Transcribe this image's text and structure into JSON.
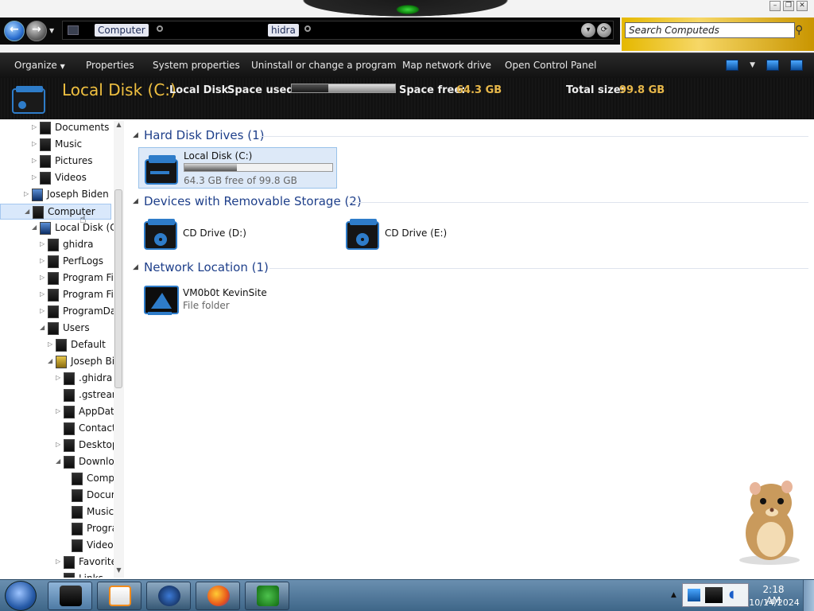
{
  "window": {
    "controls": [
      "–",
      "❐",
      "✕"
    ]
  },
  "address_bar": {
    "crumbs": [
      "Computer",
      "hidra"
    ]
  },
  "search": {
    "placeholder": "Search Computeds"
  },
  "toolbar": {
    "organize": "Organize",
    "properties": "Properties",
    "system_properties": "System properties",
    "uninstall": "Uninstall or change a program",
    "map_drive": "Map network drive",
    "control_panel": "Open Control Panel"
  },
  "details": {
    "title": "Local Disk (C:)",
    "type": "Local Disk",
    "space_used_label": "Space used:",
    "space_used_fraction": 0.355,
    "space_free_label": "Space free:",
    "space_free_value": "64.3 GB",
    "total_size_label": "Total size:",
    "total_size_value": "99.8 GB"
  },
  "nav_tree": [
    {
      "label": "Documents",
      "indent": 2,
      "icon": "documents-icon",
      "expand": "closed"
    },
    {
      "label": "Music",
      "indent": 2,
      "icon": "music-icon",
      "expand": "closed"
    },
    {
      "label": "Pictures",
      "indent": 2,
      "icon": "pictures-icon",
      "expand": "closed"
    },
    {
      "label": "Videos",
      "indent": 2,
      "icon": "videos-icon",
      "expand": "closed"
    },
    {
      "label": "Joseph Biden",
      "indent": 1,
      "icon": "user-folder-icon",
      "expand": "closed"
    },
    {
      "label": "Computer",
      "indent": 1,
      "icon": "computer-icon",
      "expand": "open",
      "selected": true
    },
    {
      "label": "Local Disk (C:)",
      "indent": 2,
      "icon": "drive-icon",
      "expand": "open"
    },
    {
      "label": "ghidra",
      "indent": 3,
      "icon": "folder-icon",
      "expand": "closed"
    },
    {
      "label": "PerfLogs",
      "indent": 3,
      "icon": "folder-icon",
      "expand": "closed"
    },
    {
      "label": "Program Files",
      "indent": 3,
      "icon": "folder-icon",
      "expand": "closed"
    },
    {
      "label": "Program Files",
      "indent": 3,
      "icon": "folder-icon",
      "expand": "closed"
    },
    {
      "label": "ProgramData",
      "indent": 3,
      "icon": "folder-icon",
      "expand": "closed"
    },
    {
      "label": "Users",
      "indent": 3,
      "icon": "folder-icon",
      "expand": "open"
    },
    {
      "label": "Default",
      "indent": 4,
      "icon": "folder-icon",
      "expand": "closed"
    },
    {
      "label": "Joseph Biden",
      "indent": 4,
      "icon": "user-folder-icon",
      "expand": "open"
    },
    {
      "label": ".ghidra",
      "indent": 5,
      "icon": "folder-icon",
      "expand": "closed"
    },
    {
      "label": ".gstreamer",
      "indent": 5,
      "icon": "folder-icon",
      "expand": "none"
    },
    {
      "label": "AppData",
      "indent": 5,
      "icon": "folder-icon",
      "expand": "closed"
    },
    {
      "label": "Contacts",
      "indent": 5,
      "icon": "folder-icon",
      "expand": "none"
    },
    {
      "label": "Desktop",
      "indent": 5,
      "icon": "folder-icon",
      "expand": "closed"
    },
    {
      "label": "Downloads",
      "indent": 5,
      "icon": "folder-icon",
      "expand": "open"
    },
    {
      "label": "Compressed",
      "indent": 6,
      "icon": "folder-icon",
      "expand": "none"
    },
    {
      "label": "Documents",
      "indent": 6,
      "icon": "folder-icon",
      "expand": "none"
    },
    {
      "label": "Music",
      "indent": 6,
      "icon": "folder-icon",
      "expand": "none"
    },
    {
      "label": "Programs",
      "indent": 6,
      "icon": "folder-icon",
      "expand": "none"
    },
    {
      "label": "Video",
      "indent": 6,
      "icon": "folder-icon",
      "expand": "none"
    },
    {
      "label": "Favorites",
      "indent": 5,
      "icon": "folder-icon",
      "expand": "closed"
    },
    {
      "label": "Links",
      "indent": 5,
      "icon": "folder-icon",
      "expand": "none"
    }
  ],
  "groups": {
    "hdd": {
      "title": "Hard Disk Drives (1)"
    },
    "removable": {
      "title": "Devices with Removable Storage (2)"
    },
    "network": {
      "title": "Network Location (1)"
    }
  },
  "items": {
    "local_disk": {
      "name": "Local Disk (C:)",
      "detail": "64.3 GB free of 99.8 GB",
      "used_fraction": 0.355
    },
    "cd_d": {
      "name": "CD Drive (D:)"
    },
    "cd_e": {
      "name": "CD Drive (E:)"
    },
    "network_folder": {
      "name": "VM0b0t KevinSite",
      "detail": "File folder"
    }
  },
  "taskbar": {
    "time": "2:18 AM",
    "date": "10/14/2024",
    "apps": [
      "explorer",
      "media-player",
      "ie",
      "firefox",
      "idm"
    ]
  },
  "colors": {
    "accent_gold": "#e8b84a",
    "group_title": "#1e3f8a",
    "selection": "#dde9f8"
  }
}
